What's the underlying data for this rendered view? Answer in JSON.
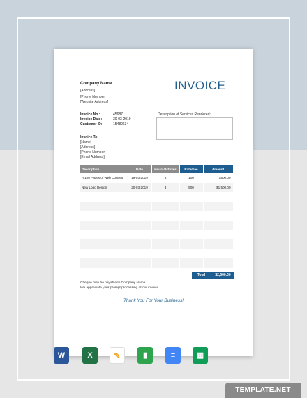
{
  "invoice": {
    "company": {
      "name": "Company Name",
      "address": "[Address]",
      "phone": "[Phone Number]",
      "website": "[Website Address]"
    },
    "title": "INVOICE",
    "meta": {
      "invoice_no_label": "Invoice No.:",
      "invoice_no": "45687",
      "date_label": "Invoice Date:",
      "date": "30-03-2019",
      "customer_label": "Customer ID:",
      "customer_id": "15489634"
    },
    "description_label": "Description of Services Rendered:",
    "invoice_to": {
      "title": "Invoice To:",
      "name": "[Name]",
      "address": "[Address]",
      "phone": "[Phone Number]",
      "email": "[Email Address]"
    },
    "table": {
      "headers": [
        "Description",
        "Date",
        "Hours/Articles",
        "Rate/Fee",
        "Amount"
      ],
      "rows": [
        [
          "A 100 Pages of Web Content",
          "19-03-2019",
          "5",
          "100",
          "$500.00"
        ],
        [
          "New Logo Design",
          "20-03-2019",
          "3",
          "500",
          "$1,500.00"
        ]
      ]
    },
    "total_label": "Total",
    "total_value": "$2,000.00",
    "note1": "Cheque may be payable to Company Name",
    "note2": "We appreciate your prompt processing of our invoice",
    "thanks": "Thank You For Your Business!"
  },
  "app_icons": [
    {
      "name": "word-icon",
      "glyph": "W"
    },
    {
      "name": "excel-icon",
      "glyph": "X"
    },
    {
      "name": "pages-icon",
      "glyph": "✎"
    },
    {
      "name": "numbers-icon",
      "glyph": "▮"
    },
    {
      "name": "google-docs-icon",
      "glyph": "≡"
    },
    {
      "name": "google-sheets-icon",
      "glyph": "▦"
    }
  ],
  "brand": "TEMPLATE.NET"
}
